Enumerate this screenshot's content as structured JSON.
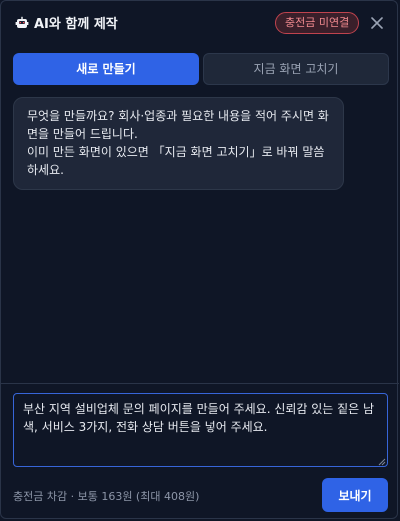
{
  "header": {
    "logo_icon": "robot-icon",
    "title": "AI와 함께 제작",
    "badge": "충전금 미연결",
    "close_icon": "close-icon"
  },
  "tabs": [
    {
      "label": "새로 만들기",
      "active": true
    },
    {
      "label": "지금 화면 고치기",
      "active": false
    }
  ],
  "message": {
    "line1": "무엇을 만들까요? 회사·업종과 필요한 내용을 적어 주시면 화면을 만들어 드립니다.",
    "line2": "이미 만든 화면이 있으면 「지금 화면 고치기」로 바꿔 말씀하세요."
  },
  "composer": {
    "input_value": "부산 지역 설비업체 문의 페이지를 만들어 주세요. 신뢰감 있는 짙은 남색, 서비스 3가지, 전화 상담 버튼을 넣어 주세요.",
    "cost_text": "충전금 차감 · 보통 163원 (최대 408원)",
    "send_label": "보내기"
  },
  "colors": {
    "background": "#0f1626",
    "accent": "#2f63e6",
    "badge_text": "#f08a8f",
    "badge_border": "#c0434e"
  }
}
